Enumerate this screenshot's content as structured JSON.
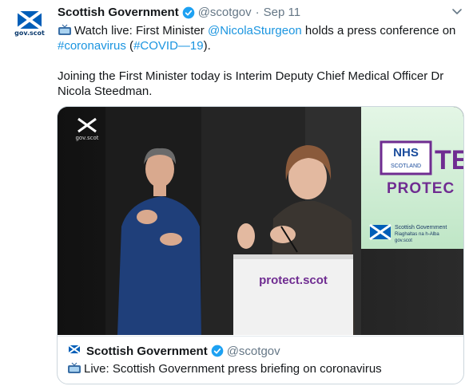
{
  "tweet": {
    "author_name": "Scottish Government",
    "handle": "@scotgov",
    "separator": "·",
    "date": "Sep 11",
    "avatar_text": "gov.scot",
    "line1_prefix": "Watch live: First Minister ",
    "mention": "@NicolaSturgeon",
    "line1_mid": " holds a press conference on ",
    "hashtag1": "#coronavirus",
    "line1_paren_open": " (",
    "hashtag2": "#COVID—19",
    "line1_paren_close": ").",
    "paragraph2": "Joining the First Minister today is Interim Deputy Chief Medical Officer Dr Nicola Steedman."
  },
  "media": {
    "watermark_text": "gov.scot",
    "lectern_text": "protect.scot",
    "banner_nhs": "NHS",
    "banner_scotland": "SCOTLAND",
    "banner_test": "TES",
    "banner_protect": "PROTEC",
    "logo_line1": "Scottish Government",
    "logo_line2": "Riaghaltas na h-Alba",
    "logo_line3": "gov.scot"
  },
  "quote": {
    "author_name": "Scottish Government",
    "handle": "@scotgov",
    "text": "Live: Scottish Government press briefing on coronavirus"
  },
  "colors": {
    "link": "#1b95e0",
    "verified": "#1da1f2",
    "saltire": "#005EB8",
    "nhs_purple": "#6f2c91",
    "banner_green": "#c9eccf"
  }
}
